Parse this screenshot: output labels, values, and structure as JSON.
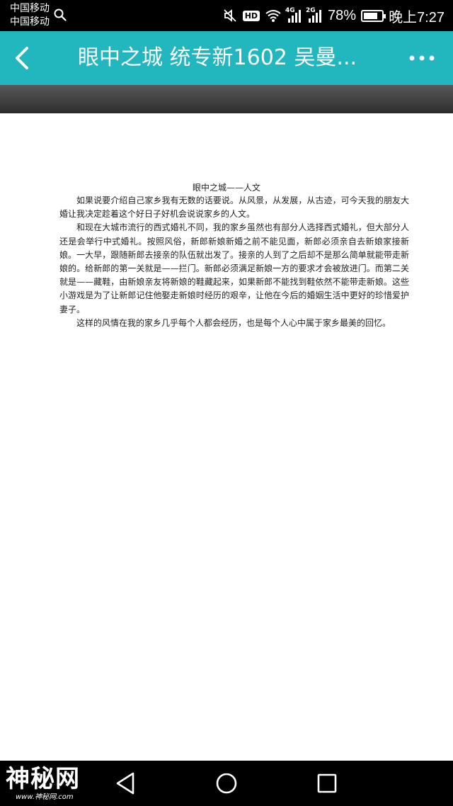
{
  "status_bar": {
    "carrier_1": "中国移动",
    "carrier_2": "中国移动",
    "hd_badge": "HD",
    "network_1": "4G",
    "network_2": "2G",
    "battery_text": "78%",
    "battery_level": 0.78,
    "time": "晚上7:27",
    "icons": [
      "search-icon",
      "mute-icon",
      "wifi-icon",
      "signal-icon",
      "signal-icon",
      "battery-icon"
    ]
  },
  "app_bar": {
    "title": "眼中之城 统专新1602 吴曼...",
    "background_color": "#22b7bf",
    "icons": [
      "back-arrow-icon",
      "more-dots-icon"
    ]
  },
  "document": {
    "title": "眼中之城——人文",
    "paragraphs": [
      "如果说要介绍自己家乡我有无数的话要说。从风景，从发展，从古迹，可今天我的朋友大婚让我决定趁着这个好日子好机会说说家乡的人文。",
      "和现在大城市流行的西式婚礼不同，我的家乡虽然也有部分人选择西式婚礼，但大部分人还是会举行中式婚礼。按照风俗，新郎新娘新婚之前不能见面，新郎必须亲自去新娘家接新娘。一大早，跟随新郎去接亲的队伍就出发了。接亲的人到了之后却不是那么简单就能带走新娘的。给新郎的第一关就是——拦门。新郎必须满足新娘一方的要求才会被放进门。而第二关就是——藏鞋，由新娘亲友将新娘的鞋藏起来，如果新郎不能找到鞋依然不能带走新娘。这些小游戏是为了让新郎记住他娶走新娘时经历的艰辛，让他在今后的婚姻生活中更好的珍惜爱护妻子。",
      "这样的风情在我的家乡几乎每个人都会经历，也是每个人心中属于家乡最美的回忆。"
    ]
  },
  "nav_bar": {
    "icons": [
      "back-triangle-icon",
      "home-circle-icon",
      "recents-square-icon"
    ]
  },
  "watermark": {
    "main": "神秘网",
    "sub": "www.神秘网.com"
  }
}
